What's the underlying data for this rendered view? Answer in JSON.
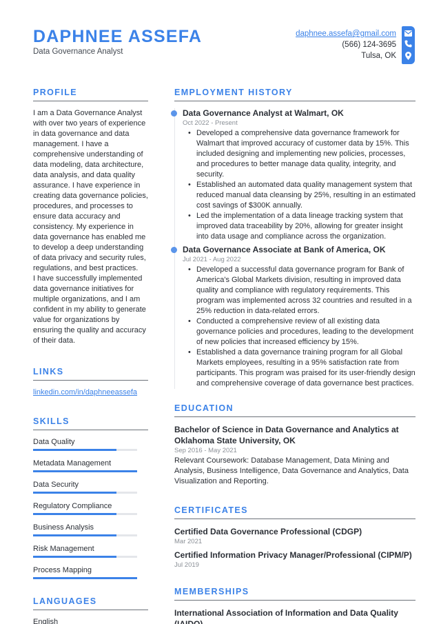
{
  "header": {
    "name": "DAPHNEE ASSEFA",
    "title": "Data Governance Analyst"
  },
  "contact": {
    "email": "daphnee.assefa@gmail.com",
    "phone": "(566) 124-3695",
    "location": "Tulsa, OK",
    "icons": [
      "envelope-icon",
      "phone-icon",
      "location-pin-icon"
    ],
    "accent_color": "#3b82e8"
  },
  "profile": {
    "heading": "PROFILE",
    "text": "I am a Data Governance Analyst with over two years of experience in data governance and data management. I have a comprehensive understanding of data modeling, data architecture, data analysis, and data quality assurance. I have experience in creating data governance policies, procedures, and processes to ensure data accuracy and consistency. My experience in data governance has enabled me to develop a deep understanding of data privacy and security rules, regulations, and best practices.",
    "text2": "I have successfully implemented data governance initiatives for multiple organizations, and I am confident in my ability to generate value for organizations by ensuring the quality and accuracy of their data."
  },
  "links": {
    "heading": "LINKS",
    "items": [
      {
        "label": "linkedin.com/in/daphneeassefa"
      }
    ]
  },
  "skills": {
    "heading": "SKILLS",
    "items": [
      {
        "name": "Data Quality",
        "level": 0.8
      },
      {
        "name": "Metadata Management",
        "level": 1.0
      },
      {
        "name": "Data Security",
        "level": 0.8
      },
      {
        "name": "Regulatory Compliance",
        "level": 0.8
      },
      {
        "name": "Business Analysis",
        "level": 0.8
      },
      {
        "name": "Risk Management",
        "level": 0.8
      },
      {
        "name": "Process Mapping",
        "level": 1.0
      }
    ]
  },
  "languages": {
    "heading": "LANGUAGES",
    "items": [
      "English"
    ]
  },
  "employment": {
    "heading": "EMPLOYMENT HISTORY",
    "jobs": [
      {
        "title": "Data Governance Analyst at Walmart, OK",
        "dates": "Oct 2022 - Present",
        "bullets": [
          "Developed a comprehensive data governance framework for Walmart that improved accuracy of customer data by 15%. This included designing and implementing new policies, processes, and procedures to better manage data quality, integrity, and security.",
          "Established an automated data quality management system that reduced manual data cleansing by 25%, resulting in an estimated cost savings of $300K annually.",
          "Led the implementation of a data lineage tracking system that improved data traceability by 20%, allowing for greater insight into data usage and compliance across the organization."
        ]
      },
      {
        "title": "Data Governance Associate at Bank of America, OK",
        "dates": "Jul 2021 - Aug 2022",
        "bullets": [
          "Developed a successful data governance program for Bank of America's Global Markets division, resulting in improved data quality and compliance with regulatory requirements. This program was implemented across 32 countries and resulted in a 25% reduction in data-related errors.",
          "Conducted a comprehensive review of all existing data governance policies and procedures, leading to the development of new policies that increased efficiency by 15%.",
          "Established a data governance training program for all Global Markets employees, resulting in a 95% satisfaction rate from participants. This program was praised for its user-friendly design and comprehensive coverage of data governance best practices."
        ]
      }
    ]
  },
  "education": {
    "heading": "EDUCATION",
    "items": [
      {
        "title": "Bachelor of Science in Data Governance and Analytics at Oklahoma State University, OK",
        "dates": "Sep 2016 - May 2021",
        "description": "Relevant Coursework: Database Management, Data Mining and Analysis, Business Intelligence, Data Governance and Analytics, Data Visualization and Reporting."
      }
    ]
  },
  "certificates": {
    "heading": "CERTIFICATES",
    "items": [
      {
        "name": "Certified Data Governance Professional (CDGP)",
        "date": "Mar 2021"
      },
      {
        "name": "Certified Information Privacy Manager/Professional (CIPM/P)",
        "date": "Jul 2019"
      }
    ]
  },
  "memberships": {
    "heading": "MEMBERSHIPS",
    "items": [
      "International Association of Information and Data Quality (IAIDQ)"
    ]
  }
}
